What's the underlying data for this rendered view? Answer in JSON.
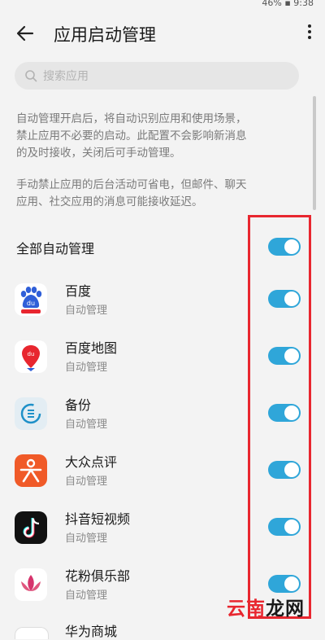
{
  "status_bar": {
    "text": "46% ▪ 9:38"
  },
  "header": {
    "title": "应用启动管理"
  },
  "search": {
    "placeholder": "搜索应用"
  },
  "description": {
    "para1": [
      "自动管理开启后，将自动识别应用和使用场景，",
      "禁止应用不必要的启动。此配置不会影响新消息",
      "的及时接收，关闭后可手动管理。"
    ],
    "para2": [
      "手动禁止应用的后台活动可省电，但邮件、聊天",
      "应用、社交应用的消息可能接收延迟。"
    ]
  },
  "all_auto": {
    "label": "全部自动管理",
    "enabled": true
  },
  "apps": [
    {
      "name": "百度",
      "status": "自动管理",
      "icon": "baidu-icon",
      "enabled": true
    },
    {
      "name": "百度地图",
      "status": "自动管理",
      "icon": "baidu-map-icon",
      "enabled": true
    },
    {
      "name": "备份",
      "status": "自动管理",
      "icon": "backup-icon",
      "enabled": true
    },
    {
      "name": "大众点评",
      "status": "自动管理",
      "icon": "dianping-icon",
      "enabled": true
    },
    {
      "name": "抖音短视频",
      "status": "自动管理",
      "icon": "douyin-icon",
      "enabled": true
    },
    {
      "name": "花粉俱乐部",
      "status": "自动管理",
      "icon": "lotus-icon",
      "enabled": true
    },
    {
      "name": "华为商城",
      "status": "",
      "icon": "vmall-icon",
      "enabled": true
    }
  ],
  "watermark": {
    "part1": "云南",
    "part2": "龙网"
  },
  "colors": {
    "toggle_on": "#2fa6d9",
    "highlight": "#e8262f"
  }
}
